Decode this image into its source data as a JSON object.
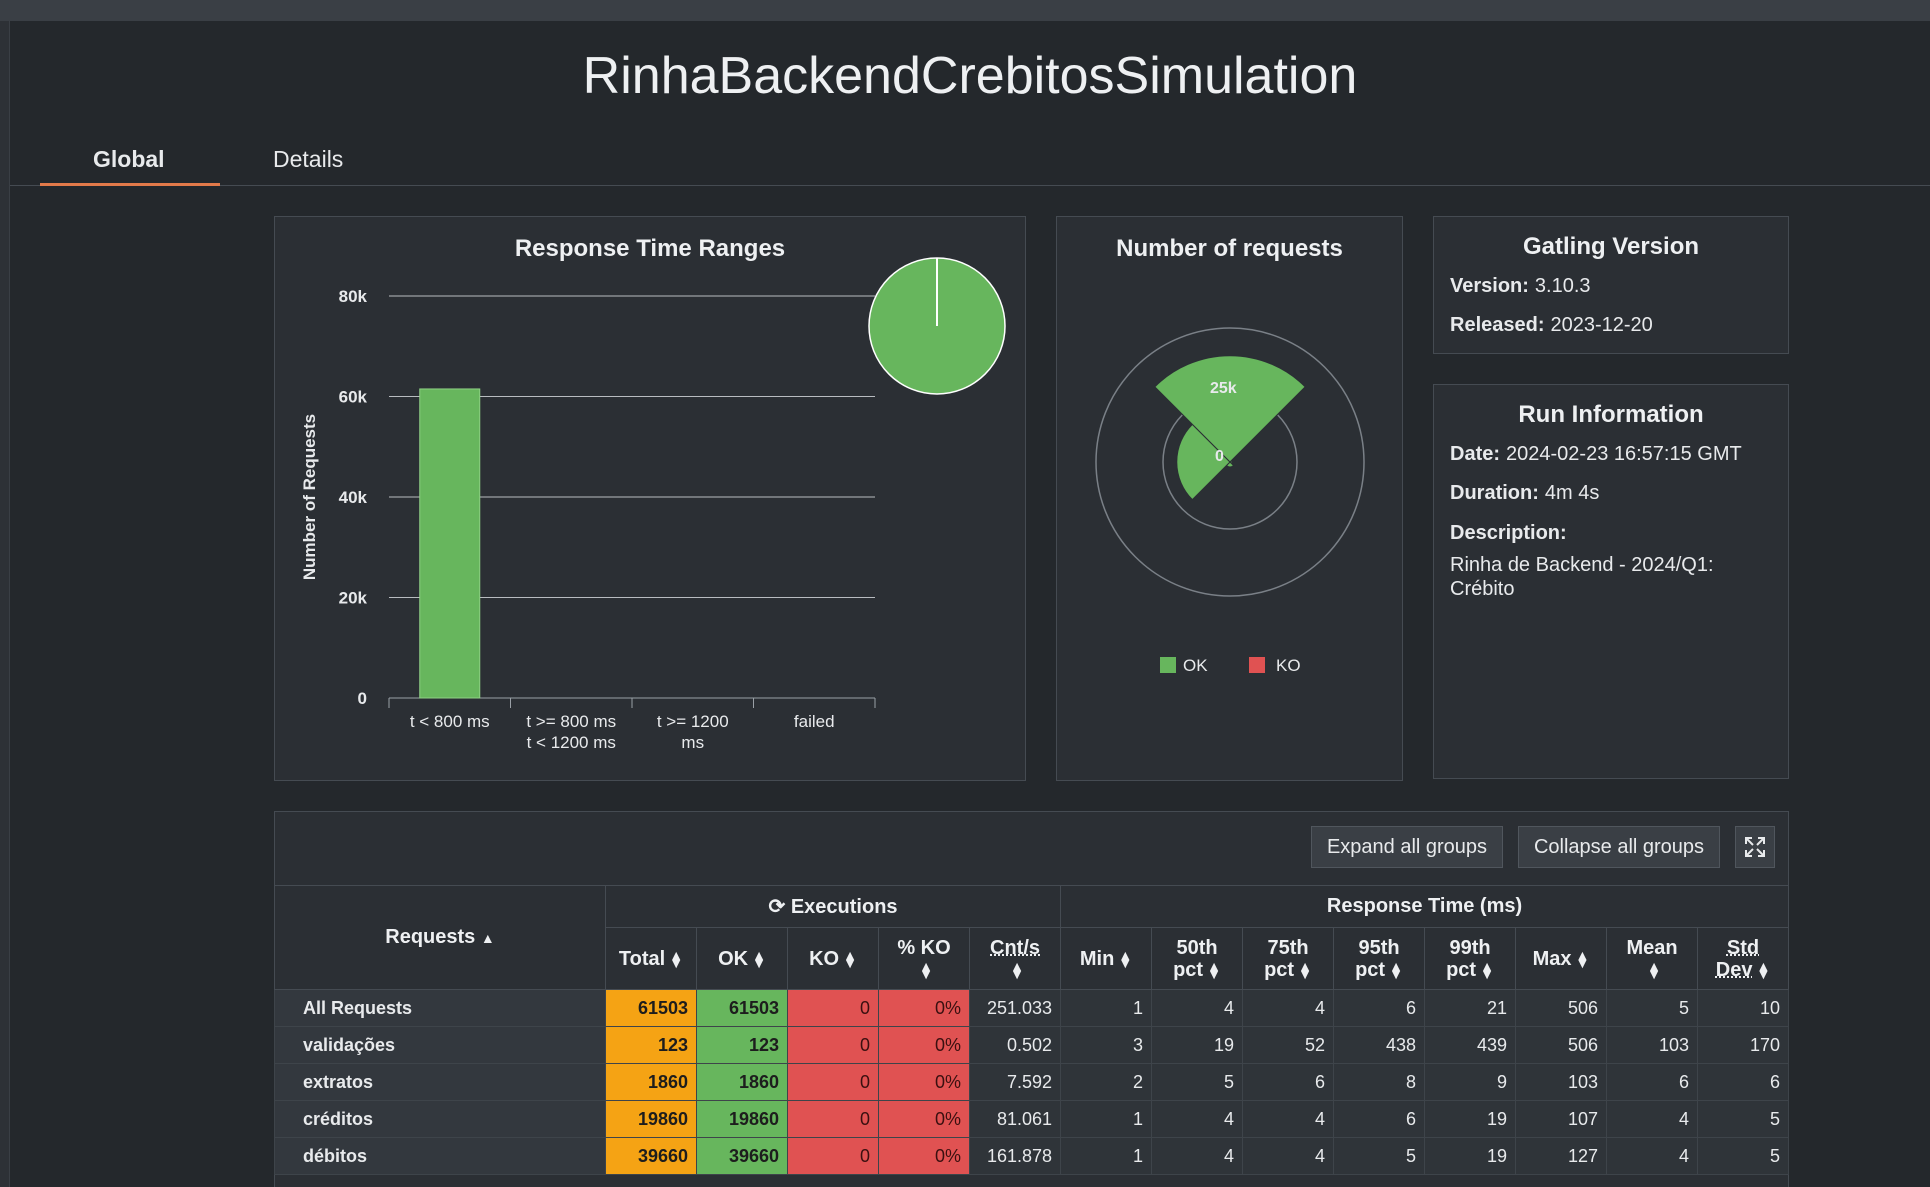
{
  "page": {
    "title": "RinhaBackendCrebitosSimulation"
  },
  "tabs": [
    {
      "label": "Global",
      "active": true
    },
    {
      "label": "Details",
      "active": false
    }
  ],
  "colors": {
    "ok": "#67b65d",
    "ko": "#e05252",
    "total": "#f5a314",
    "accent": "#e27a4a"
  },
  "charts": {
    "response_time_ranges": {
      "title": "Response Time Ranges",
      "y_label": "Number of Requests",
      "y_ticks": [
        "0",
        "20k",
        "40k",
        "60k",
        "80k"
      ]
    },
    "number_of_requests": {
      "title": "Number of requests",
      "ring_label_outer": "25k",
      "ring_label_center": "0",
      "legend": [
        "OK",
        "KO"
      ]
    }
  },
  "chart_data": [
    {
      "type": "bar",
      "title": "Response Time Ranges",
      "ylabel": "Number of Requests",
      "xlabel": "",
      "ylim": [
        0,
        80000
      ],
      "categories": [
        "t < 800 ms",
        "t >= 800 ms t < 1200 ms",
        "t >= 1200 ms",
        "failed"
      ],
      "values": [
        61503,
        0,
        0,
        0
      ],
      "grid": true
    },
    {
      "type": "pie",
      "labels": [
        "t < 800 ms",
        "t >= 800 ms t < 1200 ms",
        "t >= 1200 ms",
        "failed"
      ],
      "values": [
        61503,
        0,
        0,
        0
      ]
    },
    {
      "type": "pie",
      "title": "Number of requests",
      "legend": [
        "OK",
        "KO"
      ],
      "legend_position": "bottom",
      "categories": [
        "validações",
        "extratos",
        "créditos",
        "débitos"
      ],
      "series": [
        {
          "name": "OK",
          "values": [
            123,
            1860,
            19860,
            39660
          ]
        },
        {
          "name": "KO",
          "values": [
            0,
            0,
            0,
            0
          ]
        }
      ]
    }
  ],
  "gatling": {
    "title": "Gatling Version",
    "version_label": "Version:",
    "version": "3.10.3",
    "released_label": "Released:",
    "released": "2023-12-20"
  },
  "run": {
    "title": "Run Information",
    "date_label": "Date:",
    "date": "2024-02-23 16:57:15 GMT",
    "duration_label": "Duration:",
    "duration": "4m 4s",
    "description_label": "Description:",
    "description": "Rinha de Backend - 2024/Q1: Crébito"
  },
  "buttons": {
    "expand": "Expand all groups",
    "collapse": "Collapse all groups"
  },
  "table": {
    "group_executions": "Executions",
    "group_response": "Response Time (ms)",
    "requests_header": "Requests",
    "headers": {
      "total": "Total",
      "ok": "OK",
      "ko": "KO",
      "pko": "% KO",
      "cnt": "Cnt/s",
      "min": "Min",
      "p50a": "50th",
      "p75a": "75th",
      "p95a": "95th",
      "p99a": "99th",
      "pct": "pct",
      "max": "Max",
      "mean": "Mean",
      "stda": "Std",
      "stdb": "Dev"
    },
    "rows": [
      {
        "name": "All Requests",
        "total": "61503",
        "ok": "61503",
        "ko": "0",
        "pko": "0%",
        "cnt": "251.033",
        "min": "1",
        "p50": "4",
        "p75": "4",
        "p95": "6",
        "p99": "21",
        "max": "506",
        "mean": "5",
        "std": "10"
      },
      {
        "name": "validações",
        "total": "123",
        "ok": "123",
        "ko": "0",
        "pko": "0%",
        "cnt": "0.502",
        "min": "3",
        "p50": "19",
        "p75": "52",
        "p95": "438",
        "p99": "439",
        "max": "506",
        "mean": "103",
        "std": "170"
      },
      {
        "name": "extratos",
        "total": "1860",
        "ok": "1860",
        "ko": "0",
        "pko": "0%",
        "cnt": "7.592",
        "min": "2",
        "p50": "5",
        "p75": "6",
        "p95": "8",
        "p99": "9",
        "max": "103",
        "mean": "6",
        "std": "6"
      },
      {
        "name": "créditos",
        "total": "19860",
        "ok": "19860",
        "ko": "0",
        "pko": "0%",
        "cnt": "81.061",
        "min": "1",
        "p50": "4",
        "p75": "4",
        "p95": "6",
        "p99": "19",
        "max": "107",
        "mean": "4",
        "std": "5"
      },
      {
        "name": "débitos",
        "total": "39660",
        "ok": "39660",
        "ko": "0",
        "pko": "0%",
        "cnt": "161.878",
        "min": "1",
        "p50": "4",
        "p75": "4",
        "p95": "5",
        "p99": "19",
        "max": "127",
        "mean": "4",
        "std": "5"
      }
    ]
  }
}
